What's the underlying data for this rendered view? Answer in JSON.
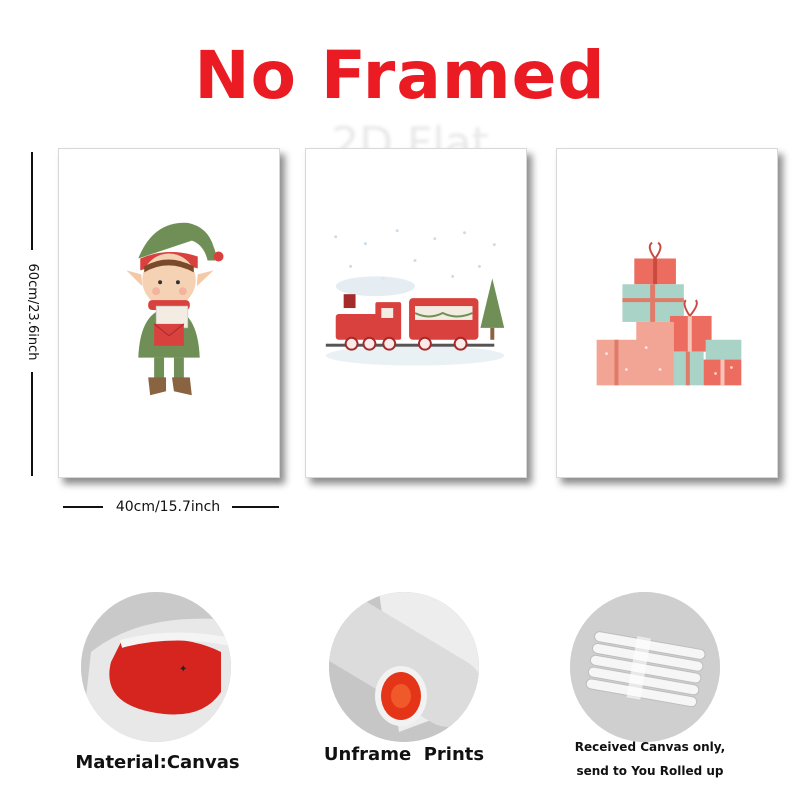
{
  "header": {
    "title": "No Framed",
    "watermark": "2D Flat"
  },
  "dimensions": {
    "height_label": "60cm/23.6inch",
    "width_label": "40cm/15.7inch"
  },
  "prints": [
    {
      "subject": "elf"
    },
    {
      "subject": "train"
    },
    {
      "subject": "gifts"
    }
  ],
  "features": [
    {
      "caption": "Material:Canvas"
    },
    {
      "caption": "Unframe  Prints"
    },
    {
      "caption_line1": "Received Canvas only,",
      "caption_line2": "send to You Rolled up"
    }
  ],
  "colors": {
    "title_red": "#ea1b23",
    "print_red": "#d9413f",
    "print_green": "#6f8f57",
    "gift_pink": "#f2a594",
    "gift_mint": "#a9d3c6"
  }
}
